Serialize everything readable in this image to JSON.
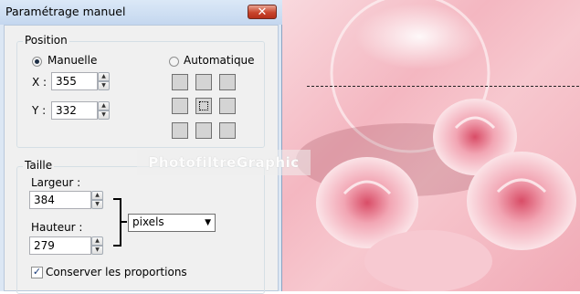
{
  "dialog": {
    "title": "Paramétrage manuel",
    "close_glyph": "✕"
  },
  "position": {
    "group_label": "Position",
    "manual_label": "Manuelle",
    "auto_label": "Automatique",
    "manual_selected": true,
    "x_label": "X :",
    "x_value": "355",
    "y_label": "Y :",
    "y_value": "332",
    "anchor_selected": "center"
  },
  "size": {
    "group_label": "Taille",
    "width_label": "Largeur :",
    "width_value": "384",
    "height_label": "Hauteur :",
    "height_value": "279",
    "unit_selected": "pixels",
    "keep_ratio_label": "Conserver les proportions",
    "keep_ratio_checked": true
  },
  "watermark": {
    "text": "PhotofiltreGraphic"
  },
  "colors": {
    "title_bar": "#c4d7ef",
    "close_button": "#c9452c",
    "image_pink": "#f4b7c1"
  }
}
